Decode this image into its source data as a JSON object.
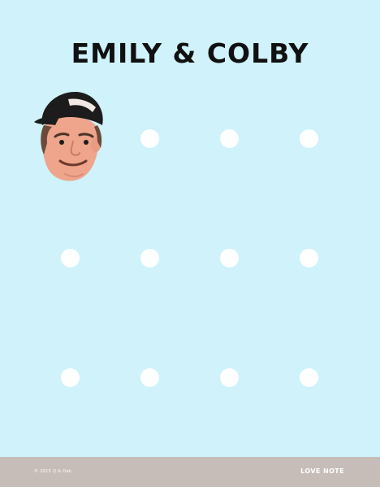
{
  "game": {
    "title": "EMILY & COLBY",
    "avatar": "colby-face-avatar",
    "grid": {
      "rows": 3,
      "cols": 4,
      "player_cell": {
        "row": 0,
        "col": 0
      }
    }
  },
  "footer": {
    "copyright": "© 2015 Q & Oak",
    "love_note_label": "LOVE NOTE"
  },
  "colors": {
    "background": "#cff2fb",
    "dot": "#ffffff",
    "title": "#111111",
    "footer": "#c6bdb9",
    "footer_text": "#ffffff"
  }
}
